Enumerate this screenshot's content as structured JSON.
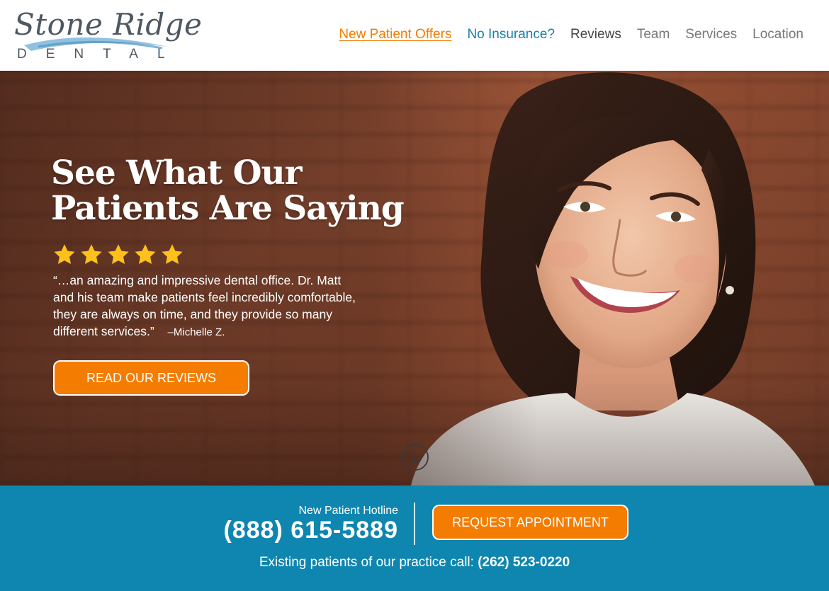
{
  "header": {
    "logo": {
      "script_text": "Stone Ridge",
      "sub_text": "DENTAL"
    },
    "nav": [
      {
        "label": "New Patient Offers"
      },
      {
        "label": "No Insurance?"
      },
      {
        "label": "Reviews"
      },
      {
        "label": "Team"
      },
      {
        "label": "Services"
      },
      {
        "label": "Location"
      }
    ]
  },
  "hero": {
    "title_line1": "See What Our",
    "title_line2": "Patients Are Saying",
    "rating": {
      "stars": 5,
      "max": 5
    },
    "quote": "“…an amazing and impressive dental office. Dr. Matt and his team make patients feel incredibly comfortable, they are always on time, and they provide so many different services.”",
    "quote_author": "–Michelle Z.",
    "button_label": "READ OUR REVIEWS",
    "scroll_icon": "arrow-down-circle-icon"
  },
  "contact_bar": {
    "hotline_label": "New Patient Hotline",
    "hotline_number": "(888) 615-5889",
    "appointment_label": "REQUEST APPOINTMENT",
    "existing_text": "Existing patients of our practice call:",
    "existing_number": "(262) 523-0220"
  },
  "colors": {
    "accent_orange": "#f47c00",
    "bar_blue": "#0f86b0",
    "link_blue": "#1a7fa6"
  }
}
